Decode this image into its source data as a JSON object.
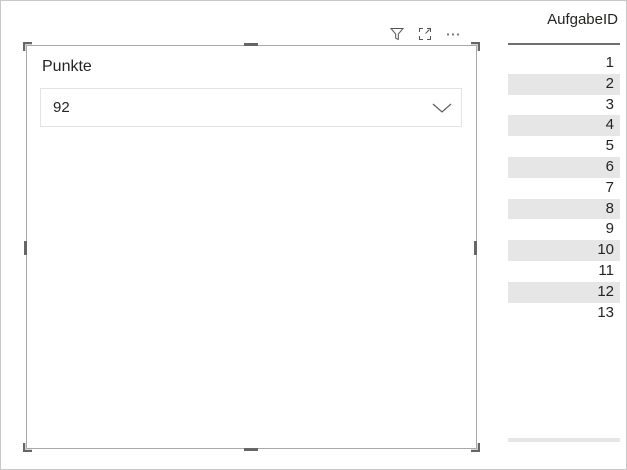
{
  "slicer": {
    "title": "Punkte",
    "selected_value": "92"
  },
  "visual_header": {
    "icons": [
      "filter-icon",
      "focus-mode-icon",
      "more-options-icon"
    ],
    "more_label": "⋯"
  },
  "table": {
    "header": "AufgabeID",
    "rows": [
      "1",
      "2",
      "3",
      "4",
      "5",
      "6",
      "7",
      "8",
      "9",
      "10",
      "11",
      "12",
      "13"
    ]
  },
  "colors": {
    "border": "#a9a9a9",
    "row_alt": "#e6e6e6",
    "text": "#252423"
  }
}
